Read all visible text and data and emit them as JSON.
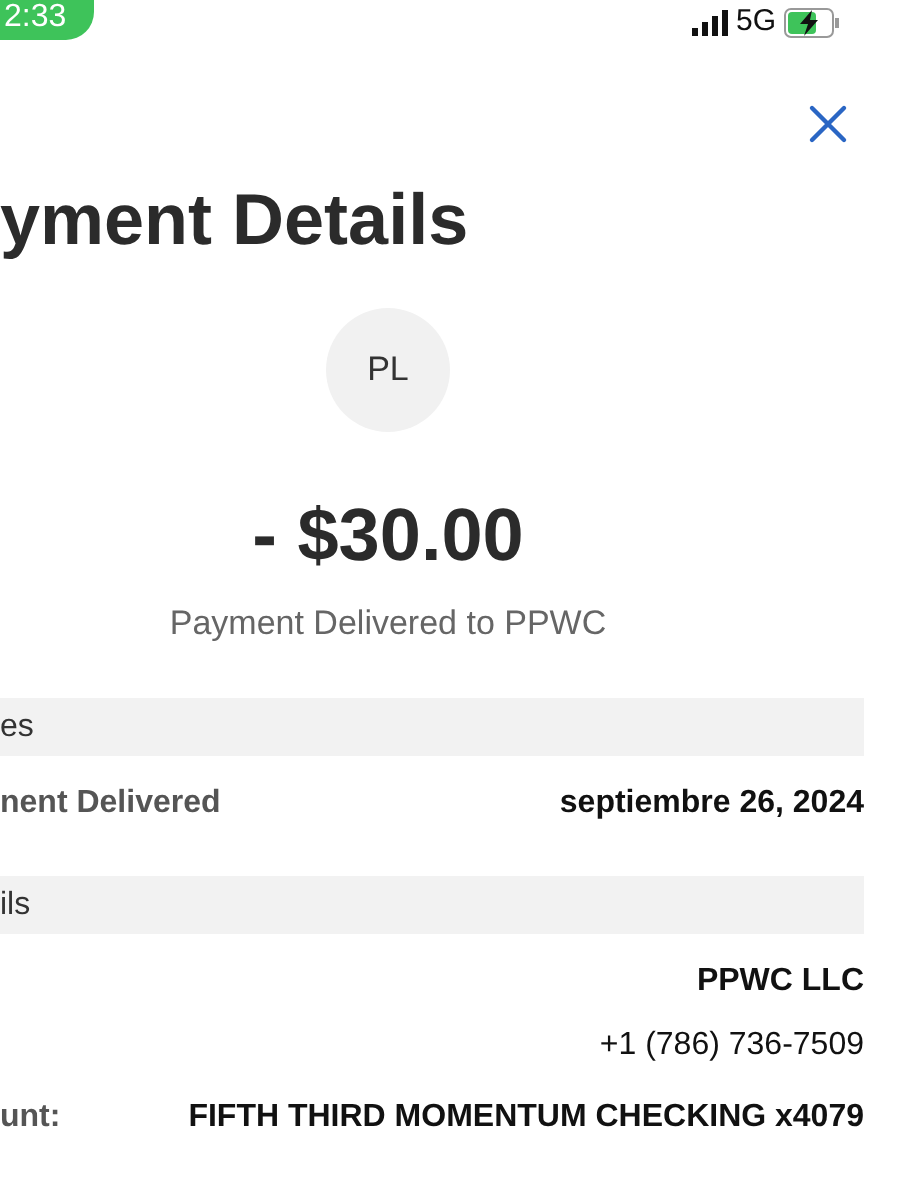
{
  "status_bar": {
    "time": "2:33",
    "network": "5G",
    "charging": true
  },
  "title": "yment Details",
  "avatar": {
    "initials": "PL"
  },
  "amount": "- $30.00",
  "subtitle": "Payment Delivered to PPWC",
  "sections": [
    {
      "header": "es",
      "rows": [
        {
          "label": "nent Delivered",
          "label_bold": true,
          "values": [
            {
              "text": "septiembre 26, 2024",
              "bold": true
            }
          ]
        }
      ]
    },
    {
      "header": "ils",
      "rows": [
        {
          "values": [
            {
              "text": "PPWC LLC",
              "bold": true
            },
            {
              "text": "+1 (786) 736-7509",
              "bold": false
            }
          ]
        },
        {
          "label": "unt:",
          "label_bold": true,
          "values": [
            {
              "text": "FIFTH THIRD MOMENTUM CHECKING x4079",
              "bold": true
            }
          ]
        }
      ]
    }
  ]
}
